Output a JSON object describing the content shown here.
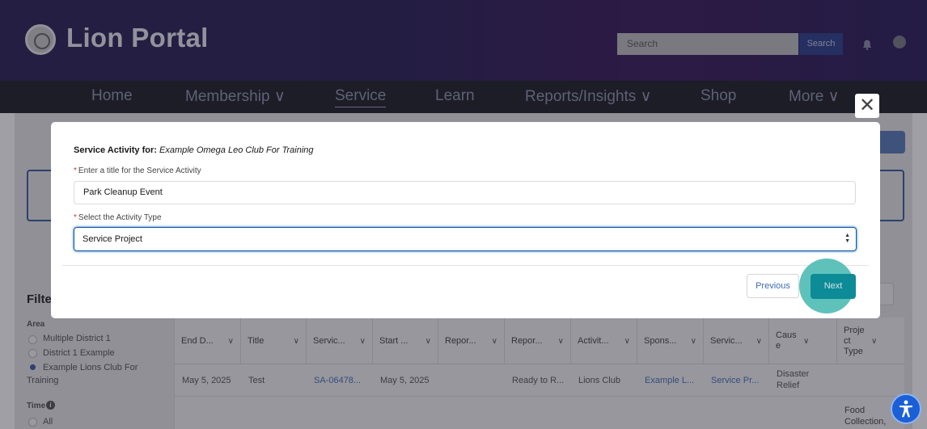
{
  "header": {
    "brand": "Lion Portal",
    "search_placeholder": "Search",
    "search_button": "Search"
  },
  "nav": {
    "items": [
      {
        "label": "Home"
      },
      {
        "label": "Membership ∨"
      },
      {
        "label": "Service"
      },
      {
        "label": "Learn"
      },
      {
        "label": "Reports/Insights ∨"
      },
      {
        "label": "Shop"
      },
      {
        "label": "More ∨"
      }
    ],
    "active": "Service"
  },
  "sidebar": {
    "filter_title": "Filte",
    "area_label": "Area",
    "area_options": [
      "Multiple District 1",
      "District 1 Example",
      "Example Lions Club For",
      "Training"
    ],
    "area_selected": "Example Lions Club For Training",
    "time_label": "Time",
    "time_options": [
      "All"
    ]
  },
  "table": {
    "columns": [
      "End D...",
      "Title",
      "Servic...",
      "Start ...",
      "Repor...",
      "Repor...",
      "Activit...",
      "Spons...",
      "Servic...",
      "Caus e",
      "Proje ct Type"
    ],
    "rows": [
      {
        "end_date": "May 5, 2025",
        "title": "Test",
        "service_id": "SA-06478...",
        "start_date": "May 5, 2025",
        "report_status": "Ready to R...",
        "activity_level": "Lions Club",
        "sponsor": "Example L...",
        "service_type": "Service Pr...",
        "cause": "Disaster Relief"
      }
    ],
    "partial_row": {
      "project_type": "Food Collection,"
    }
  },
  "modal": {
    "heading_prefix": "Service Activity for:",
    "heading_club": "Example Omega Leo Club For Training",
    "title_label": "Enter a title for the Service Activity",
    "title_value": "Park Cleanup Event",
    "type_label": "Select the Activity Type",
    "type_value": "Service Project",
    "required_mark": "*",
    "previous_button": "Previous",
    "next_button": "Next",
    "close_symbol": "✕"
  },
  "colors": {
    "header_bg": "#2c2257",
    "nav_bg": "#1e1f26",
    "next_button": "#0d8b96",
    "highlight": "#5ec2bb",
    "link": "#4a72b8"
  }
}
